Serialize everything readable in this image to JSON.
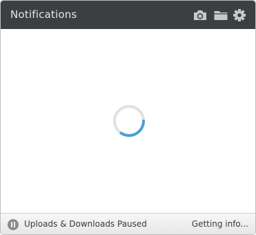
{
  "header": {
    "title": "Notifications",
    "icons": [
      "camera-icon",
      "folder-icon",
      "gear-icon"
    ]
  },
  "main": {
    "loading": true,
    "spinner_color": "#4aa0d8"
  },
  "footer": {
    "status": "Uploads & Downloads Paused",
    "info": "Getting info..."
  },
  "colors": {
    "header_bg": "#3c3f42",
    "header_icon": "#c8c8c8",
    "accent": "#4aa0d8"
  }
}
